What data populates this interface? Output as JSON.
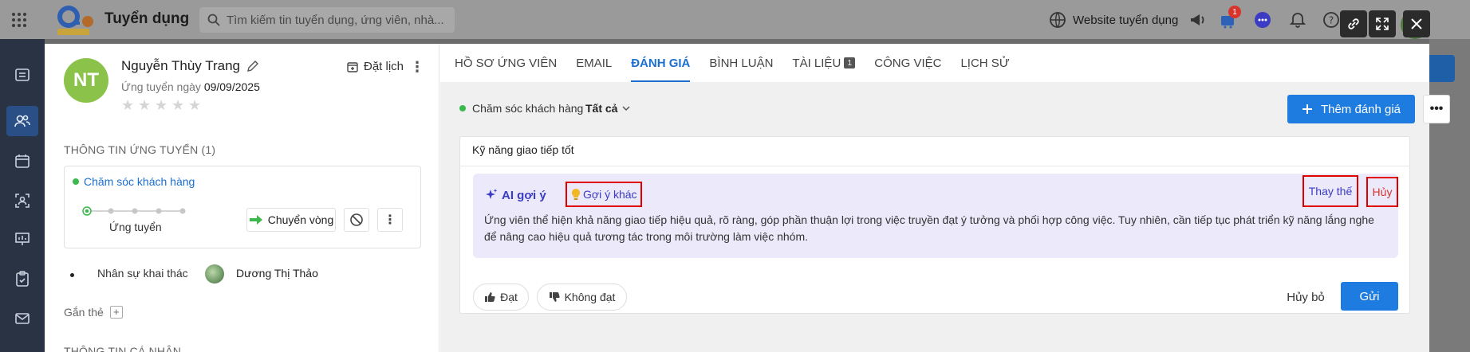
{
  "app": {
    "title": "Tuyển dụng",
    "search_placeholder": "Tìm kiếm tin tuyển dụng, ứng viên, nhà...",
    "website_label": "Website tuyển dụng",
    "notification_count": "1"
  },
  "candidate": {
    "initials": "NT",
    "name": "Nguyễn Thùy Trang",
    "applied_prefix": "Ứng tuyển ngày",
    "applied_date": "09/09/2025",
    "rating": 0,
    "schedule_label": "Đặt lịch"
  },
  "application": {
    "section_title": "THÔNG TIN ỨNG TUYỂN (1)",
    "pipeline_name": "Chăm sóc khách hàng",
    "stage": "Ứng tuyển",
    "move_label": "Chuyển vòng",
    "owner_label": "Nhân sự khai thác",
    "owner_name": "Dương Thị Thảo",
    "tag_label": "Gắn thẻ",
    "personal_section": "THÔNG TIN CÁ NHÂN"
  },
  "tabs": [
    {
      "label": "HỒ SƠ ỨNG VIÊN"
    },
    {
      "label": "EMAIL"
    },
    {
      "label": "ĐÁNH GIÁ",
      "active": true
    },
    {
      "label": "BÌNH LUẬN"
    },
    {
      "label": "TÀI LIỆU",
      "count": "1"
    },
    {
      "label": "CÔNG VIỆC"
    },
    {
      "label": "LỊCH SỬ"
    }
  ],
  "evaluation": {
    "filter_pipeline": "Chăm sóc khách hàng",
    "filter_value": "Tất cả",
    "add_label": "Thêm đánh giá",
    "input_value": "Kỹ năng giao tiếp tốt",
    "ai_label": "AI gợi ý",
    "other_suggest_label": "Gợi ý khác",
    "replace_label": "Thay thế",
    "cancel_ai_label": "Hủy",
    "ai_text": "Ứng viên thể hiện khả năng giao tiếp hiệu quả, rõ ràng, góp phần thuận lợi trong việc truyền đạt ý tưởng và phối hợp công việc. Tuy nhiên, cần tiếp tục phát triển kỹ năng lắng nghe để nâng cao hiệu quả tương tác trong môi trường làm việc nhóm.",
    "pass_label": "Đạt",
    "fail_label": "Không đạt",
    "dismiss_label": "Hủy bỏ",
    "send_label": "Gửi"
  },
  "colors": {
    "primary": "#1e7be0",
    "ai_accent": "#3b3bc4",
    "highlight_box": "#e00000",
    "avatar": "#8bc34a"
  }
}
